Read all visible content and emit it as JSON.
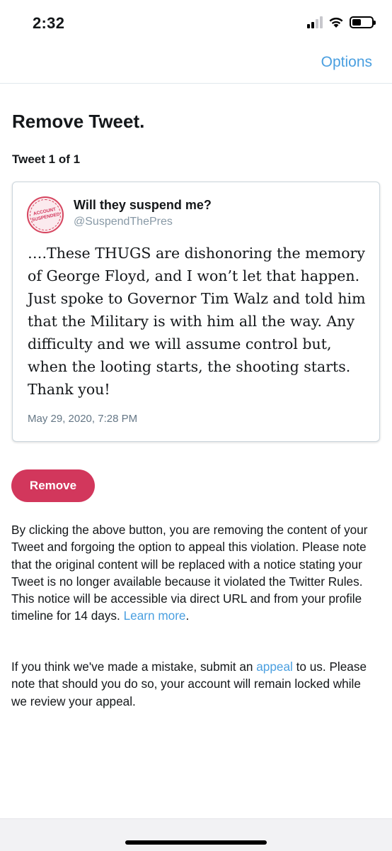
{
  "status_bar": {
    "time": "2:32",
    "signal_strength": 2,
    "signal_bars": 4,
    "battery_level": 0.45
  },
  "nav": {
    "options_label": "Options",
    "accent_color": "#4a9fe0"
  },
  "page": {
    "title": "Remove Tweet.",
    "tweet_count": "Tweet 1 of 1"
  },
  "tweet": {
    "author_name": "Will they suspend me?",
    "author_handle": "@SuspendThePres",
    "avatar_icon": "account-suspended-stamp-icon",
    "text": "….These THUGS are dishonoring the memory of George Floyd, and I won’t let that happen. Just spoke to Governor Tim Walz and told him that the Military is with him all the way. Any difficulty and we will assume control but, when the looting starts, the shooting starts. Thank you!",
    "date": "May 29, 2020, 7:28 PM",
    "avatar_stamp_lines": [
      "ACCOUNT",
      "SUSPENDED"
    ]
  },
  "actions": {
    "remove_label": "Remove",
    "remove_color": "#d2375c"
  },
  "notice": {
    "p1_text": "By clicking the above button, you are removing the content of your Tweet and forgoing the option to appeal this violation. Please note that the original content will be replaced with a notice stating your Tweet is no longer available because it violated the Twitter Rules. This notice will be accessible via direct URL and from your profile timeline for 14 days. ",
    "p1_link": "Learn more",
    "p1_end": ".",
    "p2_start": "If you think we've made a mistake, submit an ",
    "p2_link": "appeal",
    "p2_end": " to us. Please note that should you do so, your account will remain locked while we review your appeal."
  }
}
